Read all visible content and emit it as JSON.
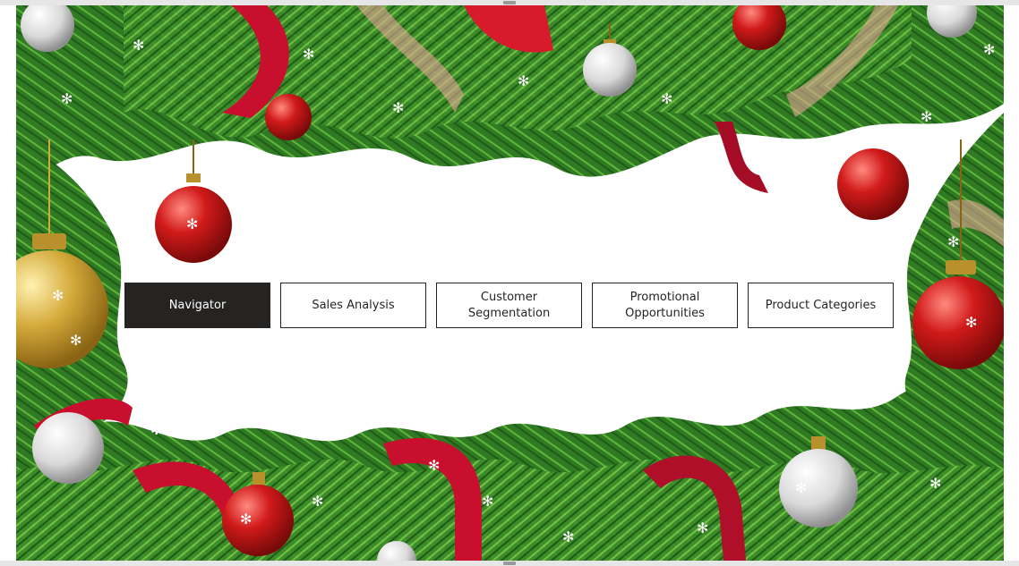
{
  "theme": {
    "canvas_bg": "#ffffff",
    "button_border": "#252423",
    "active_bg": "#252423",
    "active_text": "#ffffff",
    "garland_green": "#3f8f2e",
    "ribbon_red": "#c8102e",
    "ornament_red": "#d11a1a",
    "ornament_silver": "#d9d9d9",
    "ornament_gold": "#d4a93a"
  },
  "navigation": {
    "buttons": [
      {
        "label": "Navigator",
        "active": true
      },
      {
        "label": "Sales Analysis",
        "active": false
      },
      {
        "label": "Customer Segmentation",
        "active": false
      },
      {
        "label": "Promotional\nOpportunities",
        "active": false
      },
      {
        "label": "Product Categories",
        "active": false
      }
    ]
  },
  "decorations": {
    "background_image": "christmas-garland-frame",
    "icons": [
      "red-ornament-icon",
      "silver-ornament-icon",
      "gold-ornament-icon",
      "snowflake-icon",
      "ribbon-icon"
    ]
  }
}
